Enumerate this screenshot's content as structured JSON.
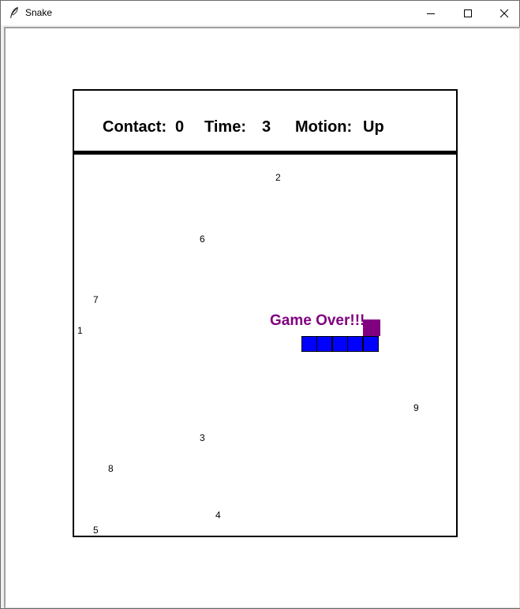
{
  "window": {
    "title": "Snake",
    "controls": {
      "minimize": "minimize-icon",
      "maximize": "maximize-icon",
      "close": "close-icon"
    }
  },
  "hud": {
    "contact_label": "Contact:",
    "contact_value": "0",
    "time_label": "Time:",
    "time_value": "3",
    "motion_label": "Motion:",
    "motion_value": "Up"
  },
  "board": {
    "numbers": [
      "2",
      "6",
      "7",
      "1",
      "9",
      "3",
      "8",
      "4",
      "5"
    ],
    "game_over_text": "Game Over!!!",
    "snake_segment_count": 5
  },
  "colors": {
    "snake": "#0000ff",
    "food": "#800080",
    "game_over": "#800080",
    "border": "#000000"
  }
}
